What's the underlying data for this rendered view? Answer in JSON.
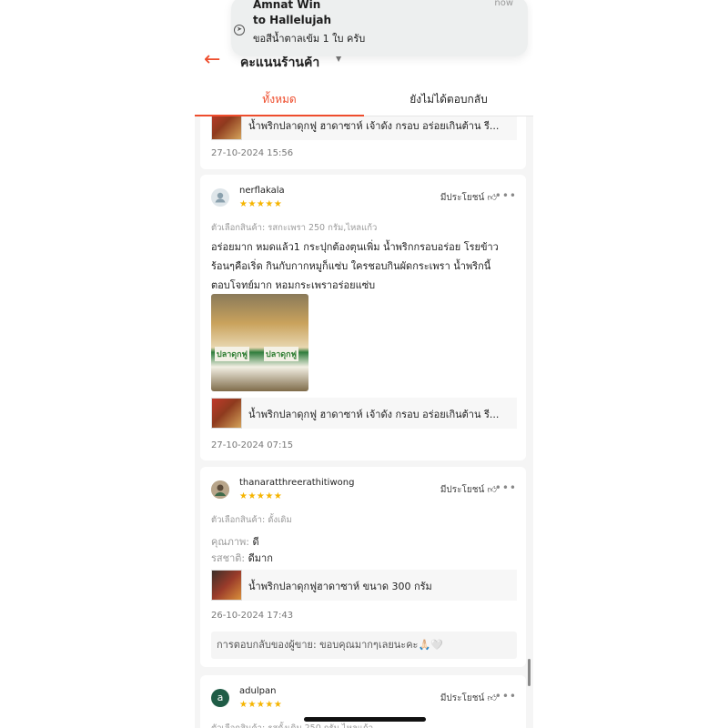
{
  "notification": {
    "title_line1": "Amnat Win",
    "title_line2": "to Hallelujah",
    "time": "now",
    "body": "ขอสีน้ำตาลเข้ม  1 ใบ ครับ"
  },
  "header": {
    "title": "คะแนนร้านค้า",
    "back_icon": "←",
    "caret": "▼"
  },
  "tabs": [
    {
      "label": "ทั้งหมด",
      "active": true
    },
    {
      "label": "ยังไม่ได้ตอบกลับ",
      "active": false
    }
  ],
  "colors": {
    "accent": "#ee4d2d",
    "star": "#f5b400"
  },
  "reviews": [
    {
      "product": "น้ำพริกปลาดุกฟู ฮาดาซาห์ เจ้าดัง กรอบ อร่อยเกินต้าน รี...",
      "date": "27-10-2024 15:56"
    },
    {
      "username": "nerflakala",
      "stars": "★★★★★",
      "rating": 5,
      "helpful": "มีประโยชน์",
      "variant": "ตัวเลือกสินค้า: รสกะเพรา 250 กรัม,ไหลแก้ว",
      "text_lines": [
        "อร่อยมาก หมดแล้ว1 กระปุกต้องตุนเพิ่ม น้ำพริกกรอบอร่อย โรยข้าว",
        "ร้อนๆคือเริ่ด กินกับกากหมูก็แซ่บ ใครชอบกินผัดกระเพรา น้ำพริกนี้",
        "ตอบโจทย์มาก หอมกระเพราอร่อยแซ่บ"
      ],
      "photo_label": "ปลาดุกฟู",
      "product": "น้ำพริกปลาดุกฟู ฮาดาซาห์ เจ้าดัง กรอบ อร่อยเกินต้าน รี...",
      "date": "27-10-2024 07:15"
    },
    {
      "username": "thanaratthreerathitiwong",
      "stars": "★★★★★",
      "rating": 5,
      "helpful": "มีประโยชน์",
      "variant": "ตัวเลือกสินค้า: ดั้งเดิม",
      "quality_key": "คุณภาพ:",
      "quality_val": "ดี",
      "taste_key": "รสชาติ:",
      "taste_val": "ดีมาก",
      "product": "น้ำพริกปลาดุกฟูฮาดาซาห์ ขนาด 300 กรัม",
      "date": "26-10-2024 17:43",
      "seller_reply_label": "การตอบกลับของผู้ขาย:",
      "seller_reply": "ขอบคุณมากๆเลยนะคะ🙏🏻🤍"
    },
    {
      "avatar_letter": "a",
      "username": "adulpan",
      "stars": "★★★★★",
      "rating": 5,
      "helpful": "มีประโยชน์",
      "variant": "ตัวเลือกสินค้า: รสดั้งเดิม 250 กรัม,ไหลแก้ว"
    }
  ]
}
